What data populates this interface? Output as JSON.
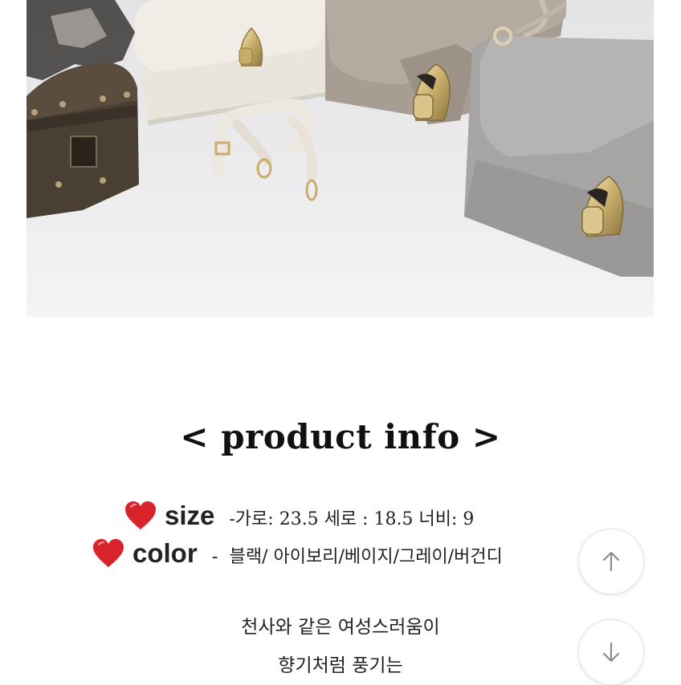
{
  "photo": {
    "subject": "handbags-product-photo"
  },
  "product_info": {
    "title": "< product info >",
    "size": {
      "label": "size",
      "value": "-가로: 23.5  세로 : 18.5  너비: 9"
    },
    "color": {
      "label": "color",
      "dash": "-",
      "value": "블랙/ 아이보리/베이지/그레이/버건디"
    }
  },
  "description": {
    "line1": "천사와 같은 여성스러움이",
    "line2": "향기처럼 풍기는"
  },
  "scroll_buttons": {
    "up_icon": "arrow-up-icon",
    "down_icon": "arrow-down-icon"
  },
  "colors": {
    "heart": "#d8232a",
    "text": "#222222",
    "photo_bg": "#eeeeef"
  }
}
